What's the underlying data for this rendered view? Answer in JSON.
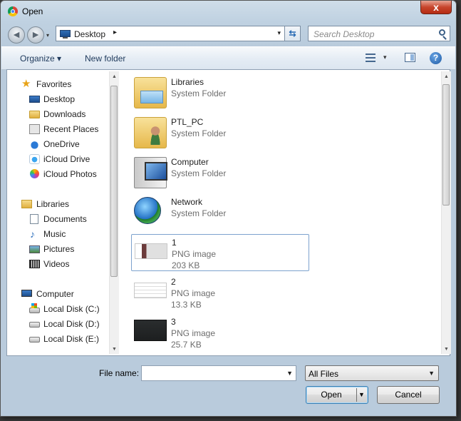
{
  "window": {
    "title": "Open",
    "close_label": "x"
  },
  "address": {
    "location": "Desktop",
    "chevron": "▸",
    "dropdown": "▾"
  },
  "search": {
    "placeholder": "Search Desktop"
  },
  "toolbar": {
    "organize": "Organize ▾",
    "new_folder": "New folder",
    "view_dropdown": "▾",
    "help": "?"
  },
  "nav": {
    "favorites": "Favorites",
    "favorite_items": [
      "Desktop",
      "Downloads",
      "Recent Places",
      "OneDrive",
      "iCloud Drive",
      "iCloud Photos"
    ],
    "libraries": "Libraries",
    "library_items": [
      "Documents",
      "Music",
      "Pictures",
      "Videos"
    ],
    "computer": "Computer",
    "computer_items": [
      "Local Disk (C:)",
      "Local Disk (D:)",
      "Local Disk (E:)"
    ]
  },
  "files": [
    {
      "name": "Libraries",
      "type": "System Folder",
      "size": "",
      "icon": "libraries-icon"
    },
    {
      "name": "PTL_PC",
      "type": "System Folder",
      "size": "",
      "icon": "user-folder-icon"
    },
    {
      "name": "Computer",
      "type": "System Folder",
      "size": "",
      "icon": "computer-icon"
    },
    {
      "name": "Network",
      "type": "System Folder",
      "size": "",
      "icon": "network-icon"
    },
    {
      "name": "1",
      "type": "PNG image",
      "size": "203 KB",
      "icon": "png-thumbnail-icon"
    },
    {
      "name": "2",
      "type": "PNG image",
      "size": "13.3 KB",
      "icon": "png-thumbnail-icon"
    },
    {
      "name": "3",
      "type": "PNG image",
      "size": "25.7 KB",
      "icon": "png-thumbnail-icon"
    }
  ],
  "bottom": {
    "file_name_label": "File name:",
    "file_name_value": "",
    "file_type": "All Files",
    "open_label": "Open",
    "cancel_label": "Cancel"
  }
}
